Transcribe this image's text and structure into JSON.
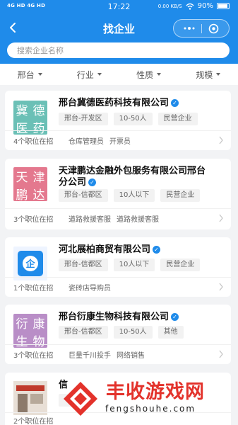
{
  "status_bar": {
    "network": "4G HD 4G HD",
    "time": "17:22",
    "speed": "0.00 KB/S",
    "battery": "90%"
  },
  "nav": {
    "title": "找企业"
  },
  "search": {
    "placeholder": "搜索企业名称"
  },
  "filters": [
    {
      "label": "邢台"
    },
    {
      "label": "行业"
    },
    {
      "label": "性质"
    },
    {
      "label": "规模"
    }
  ],
  "companies": [
    {
      "logo_text": [
        "冀",
        "德",
        "医",
        "药"
      ],
      "logo_color": "#6bc0b6",
      "name": "邢台冀德医药科技有限公司",
      "tags": [
        "邢台-开发区",
        "10-50人",
        "民营企业"
      ],
      "count": "4个职位在招",
      "jobs": [
        "仓库管理员",
        "开票员"
      ]
    },
    {
      "logo_text": [
        "天",
        "津",
        "鹏",
        "达"
      ],
      "logo_color": "#e4788e",
      "name_lines": [
        "天津鹏达金融外包服务有限公司邢台",
        "分公司"
      ],
      "tags": [
        "邢台-信都区",
        "10人以下",
        "民营企业"
      ],
      "count": "3个职位在招",
      "jobs": [
        "道路救援客服",
        "道路救援客服"
      ]
    },
    {
      "logo_text": [
        "企"
      ],
      "logo_color": "#1f8bea",
      "name": "河北展柏商贸有限公司",
      "tags": [
        "邢台-信都区",
        "10人以下",
        "民营企业"
      ],
      "count": "1个职位在招",
      "jobs": [
        "瓷砖店导购员"
      ]
    },
    {
      "logo_text": [
        "衍",
        "康",
        "生",
        "物"
      ],
      "logo_color": "#b98ec7",
      "name": "邢台衍康生物科技有限公司",
      "tags": [
        "邢台-信都区",
        "10-50人",
        "其他"
      ],
      "count": "3个职位在招",
      "jobs": [
        "巨量千川投手",
        "网络销售"
      ]
    },
    {
      "name_fragment": "信",
      "count": "2个职位在招"
    }
  ],
  "watermark": {
    "title": "丰收游戏网",
    "url": "fengshouhe.com"
  },
  "colors": {
    "primary": "#1f8bea",
    "background": "#f2f3f5",
    "watermark_red": "#e3322b"
  }
}
